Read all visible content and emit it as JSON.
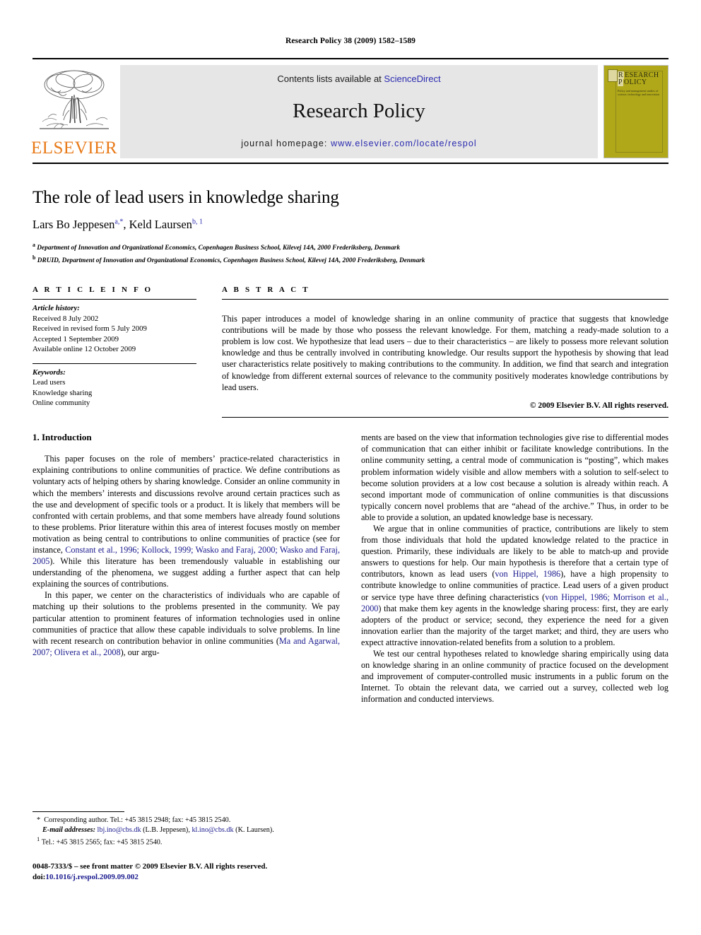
{
  "running_head": "Research Policy 38 (2009) 1582–1589",
  "masthead": {
    "publisher_name": "ELSEVIER",
    "contents_prefix": "Contents lists available at ",
    "contents_link": "ScienceDirect",
    "journal_name": "Research Policy",
    "homepage_prefix": "journal homepage: ",
    "homepage_url": "www.elsevier.com/locate/respol",
    "cover": {
      "title_line1_cap": "R",
      "title_line1_rest": "ESEARCH",
      "title_line2_cap": "P",
      "title_line2_rest": "OLICY",
      "subtitle": "Policy and management studies of science, technology and innovation"
    },
    "link_color": "#2a2ab0",
    "banner_bg": "#e6e6e6",
    "cover_bg": "#b0a818",
    "elsevier_orange": "#e87a18"
  },
  "title_block": {
    "title": "The role of lead users in knowledge sharing",
    "author1": "Lars Bo Jeppesen",
    "author1_marks": "a,*",
    "author_sep": ", ",
    "author2": "Keld Laursen",
    "author2_marks": "b, 1",
    "affiliation_a_mark": "a",
    "affiliation_a": " Department of Innovation and Organizational Economics, Copenhagen Business School, Kilevej 14A, 2000 Frederiksberg, Denmark",
    "affiliation_b_mark": "b",
    "affiliation_b": " DRUID, Department of Innovation and Organizational Economics, Copenhagen Business School, Kilevej 14A, 2000 Frederiksberg, Denmark"
  },
  "article_info": {
    "label": "A R T I C L E   I N F O",
    "history_heading": "Article history:",
    "history": [
      "Received 8 July 2002",
      "Received in revised form 5 July 2009",
      "Accepted 1 September 2009",
      "Available online 12 October 2009"
    ],
    "keywords_heading": "Keywords:",
    "keywords": [
      "Lead users",
      "Knowledge sharing",
      "Online community"
    ]
  },
  "abstract": {
    "label": "A B S T R A C T",
    "text": "This paper introduces a model of knowledge sharing in an online community of practice that suggests that knowledge contributions will be made by those who possess the relevant knowledge. For them, matching a ready-made solution to a problem is low cost. We hypothesize that lead users – due to their characteristics – are likely to possess more relevant solution knowledge and thus be centrally involved in contributing knowledge. Our results support the hypothesis by showing that lead user characteristics relate positively to making contributions to the community. In addition, we find that search and integration of knowledge from different external sources of relevance to the community positively moderates knowledge contributions by lead users.",
    "copyright": "© 2009 Elsevier B.V. All rights reserved."
  },
  "body": {
    "section_title": "1. Introduction",
    "left": {
      "p1_a": "This paper focuses on the role of members’ practice-related characteristics in explaining contributions to online communities of practice. We define contributions as voluntary acts of helping others by sharing knowledge. Consider an online community in which the members’ interests and discussions revolve around certain practices such as the use and development of specific tools or a product. It is likely that members will be confronted with certain problems, and that some members have already found solutions to these problems. Prior literature within this area of interest focuses mostly on member motivation as being central to contributions to online communities of practice (see for instance, ",
      "p1_cite": "Constant et al., 1996; Kollock, 1999; Wasko and Faraj, 2000; Wasko and Faraj, 2005",
      "p1_b": "). While this literature has been tremendously valuable in establishing our understanding of the phenomena, we suggest adding a further aspect that can help explaining the sources of contributions.",
      "p2_a": "In this paper, we center on the characteristics of individuals who are capable of matching up their solutions to the problems presented in the community. We pay particular attention to prominent features of information technologies used in online communities of practice that allow these capable individuals to solve problems. In line with recent research on contribution behavior in online communities (",
      "p2_cite": "Ma and Agarwal, 2007; Olivera et al., 2008",
      "p2_b": "), our argu-"
    },
    "right": {
      "p1": "ments are based on the view that information technologies give rise to differential modes of communication that can either inhibit or facilitate knowledge contributions. In the online community setting, a central mode of communication is “posting”, which makes problem information widely visible and allow members with a solution to self-select to become solution providers at a low cost because a solution is already within reach. A second important mode of communication of online communities is that discussions typically concern novel problems that are “ahead of the archive.” Thus, in order to be able to provide a solution, an updated knowledge base is necessary.",
      "p2_a": "We argue that in online communities of practice, contributions are likely to stem from those individuals that hold the updated knowledge related to the practice in question. Primarily, these individuals are likely to be able to match-up and provide answers to questions for help. Our main hypothesis is therefore that a certain type of contributors, known as lead users (",
      "p2_cite1": "von Hippel, 1986",
      "p2_b": "), have a high propensity to contribute knowledge to online communities of practice. Lead users of a given product or service type have three defining characteristics (",
      "p2_cite2": "von Hippel, 1986; Morrison et al., 2000",
      "p2_c": ") that make them key agents in the knowledge sharing process: first, they are early adopters of the product or service; second, they experience the need for a given innovation earlier than the majority of the target market; and third, they are users who expect attractive innovation-related benefits from a solution to a problem.",
      "p3": "We test our central hypotheses related to knowledge sharing empirically using data on knowledge sharing in an online community of practice focused on the development and improvement of computer-controlled music instruments in a public forum on the Internet. To obtain the relevant data, we carried out a survey, collected web log information and conducted interviews."
    }
  },
  "footnotes": {
    "star_mark": "*",
    "star_text": "Corresponding author. Tel.: +45 3815 2948; fax: +45 3815 2540.",
    "email_label": "E-mail addresses:",
    "email1": "lbj.ino@cbs.dk",
    "email1_owner": " (L.B. Jeppesen), ",
    "email2": "kl.ino@cbs.dk",
    "email2_owner": " (K. Laursen).",
    "note1_mark": "1",
    "note1_text": "Tel.: +45 3815 2565; fax: +45 3815 2540.",
    "issn_line": "0048-7333/$ – see front matter © 2009 Elsevier B.V. All rights reserved.",
    "doi_prefix": "doi:",
    "doi": "10.1016/j.respol.2009.09.002"
  }
}
